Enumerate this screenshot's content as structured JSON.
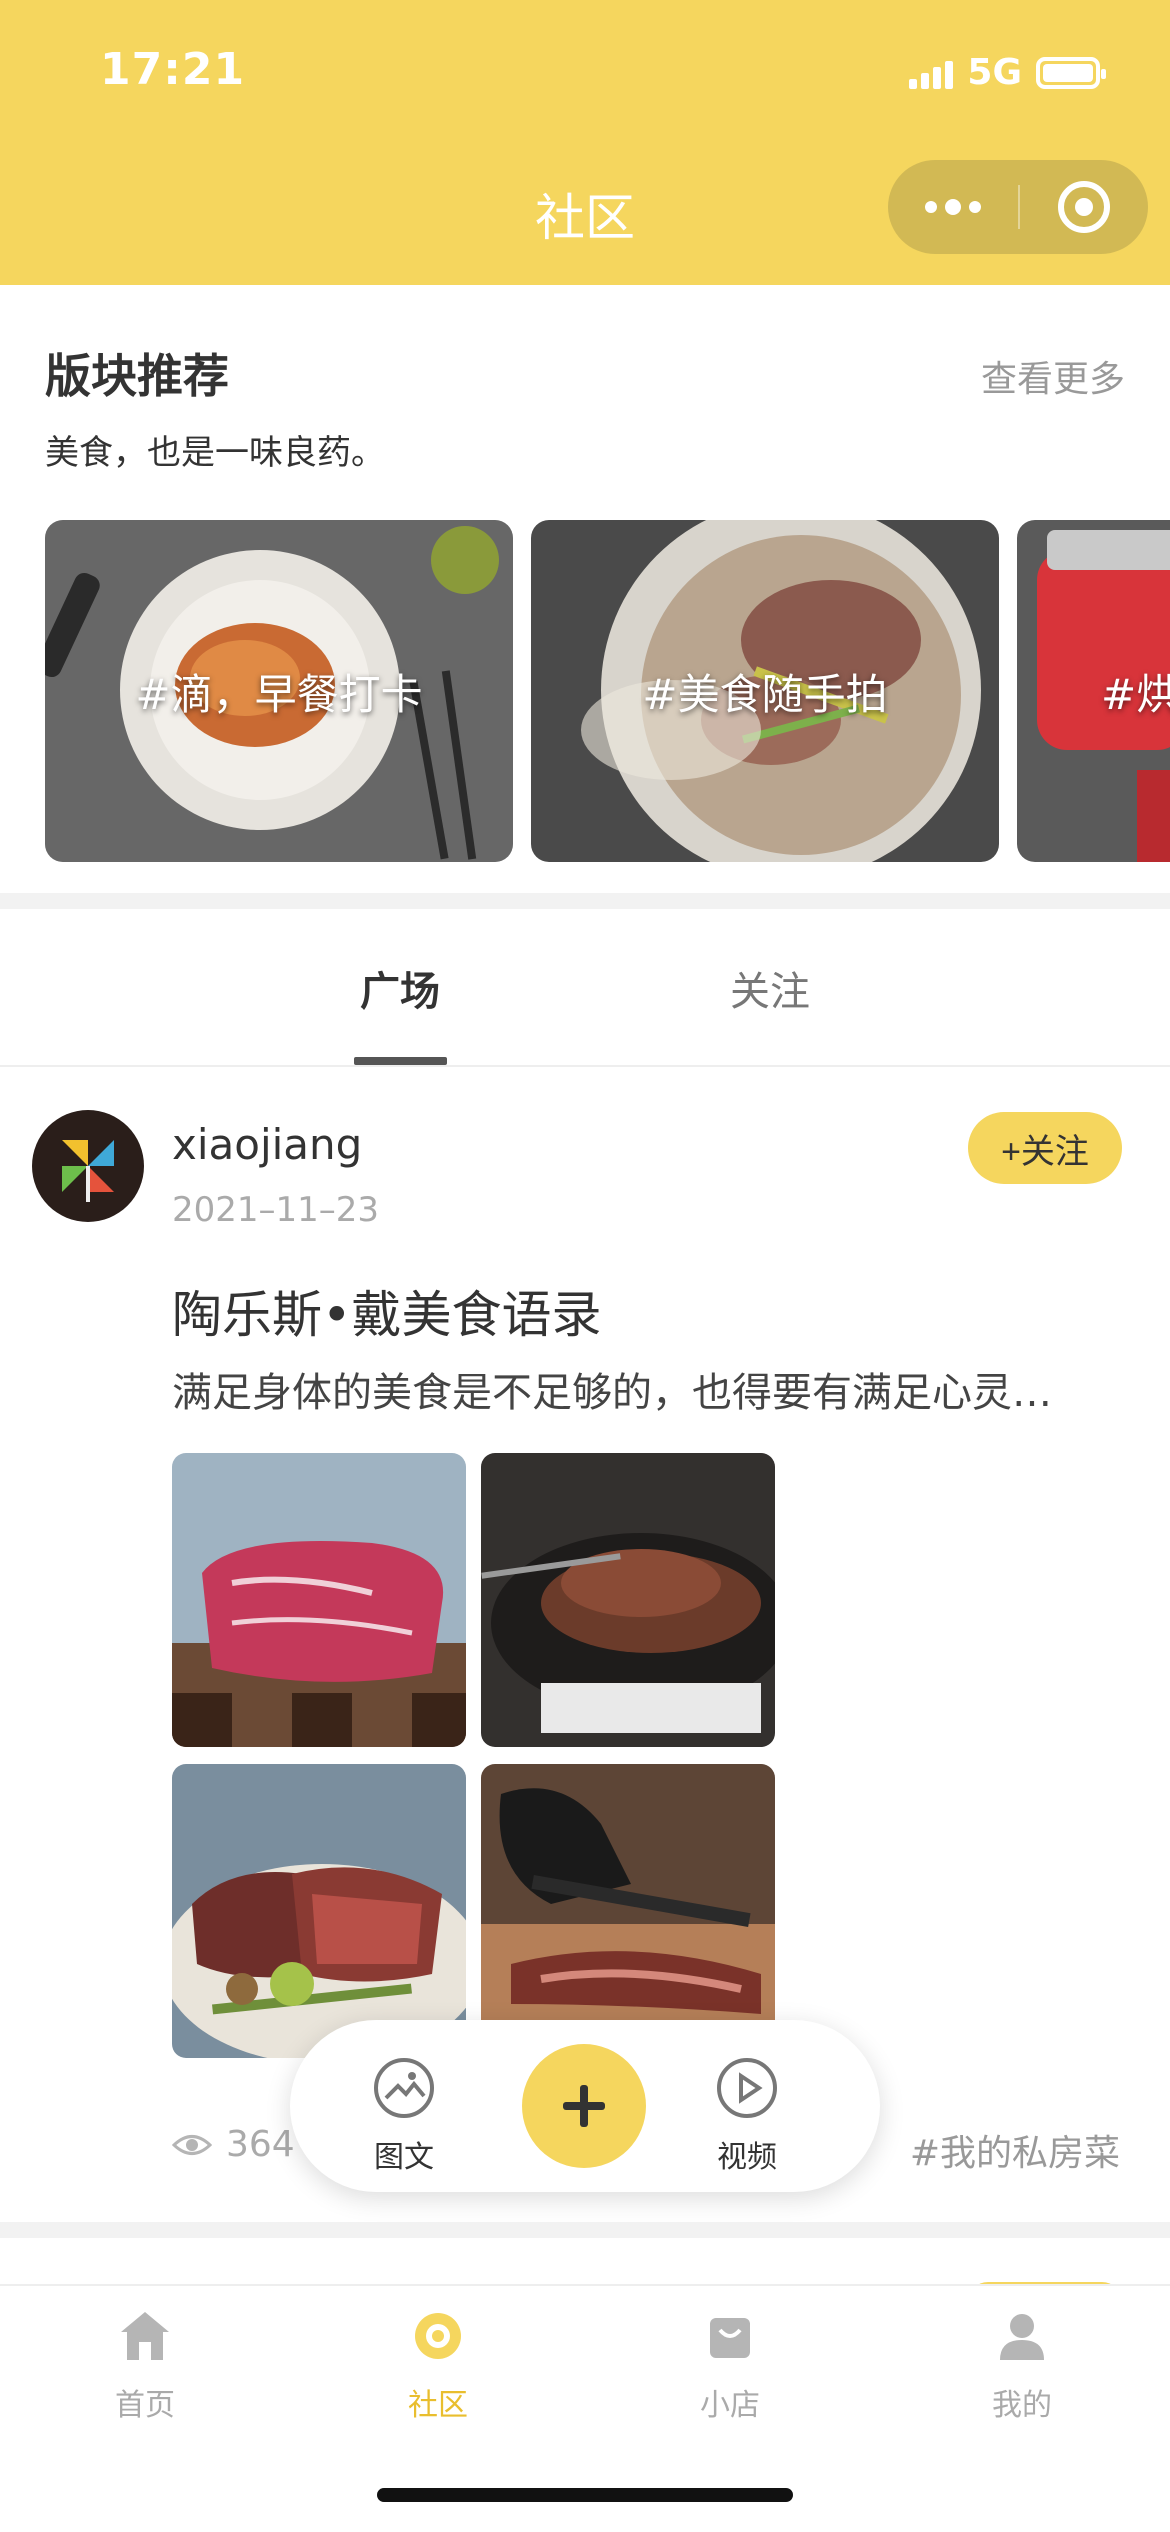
{
  "status_bar": {
    "time": "17:21",
    "network": "5G",
    "battery_level": 1.0
  },
  "nav": {
    "title": "社区",
    "more_icon": "more-dots-icon",
    "close_icon": "target-icon"
  },
  "section": {
    "title": "版块推荐",
    "more": "查看更多",
    "subtitle": "美食，也是一味良药。",
    "cards": [
      {
        "label": "#滴，早餐打卡"
      },
      {
        "label": "#美食随手拍"
      },
      {
        "label": "#烘"
      }
    ]
  },
  "tabs": {
    "items": [
      "广场",
      "关注"
    ],
    "active": "广场"
  },
  "post": {
    "username": "xiaojiang",
    "date": "2021–11–23",
    "follow": "+关注",
    "title": "陶乐斯•戴美食语录",
    "excerpt": "满足身体的美食是不足够的，也得要有满足心灵…",
    "views": "364",
    "tag": "#我的私房菜"
  },
  "publish": {
    "image_text": "图文",
    "video": "视频",
    "plus_icon": "plus-icon"
  },
  "tabbar": {
    "items": [
      {
        "label": "首页",
        "icon": "home-icon"
      },
      {
        "label": "社区",
        "icon": "community-icon",
        "active": true
      },
      {
        "label": "小店",
        "icon": "shop-icon"
      },
      {
        "label": "我的",
        "icon": "profile-icon"
      }
    ]
  },
  "colors": {
    "accent": "#F5D65E",
    "active_tab": "#E9BE2E",
    "text": "#333333",
    "muted": "#AAAAAA"
  }
}
